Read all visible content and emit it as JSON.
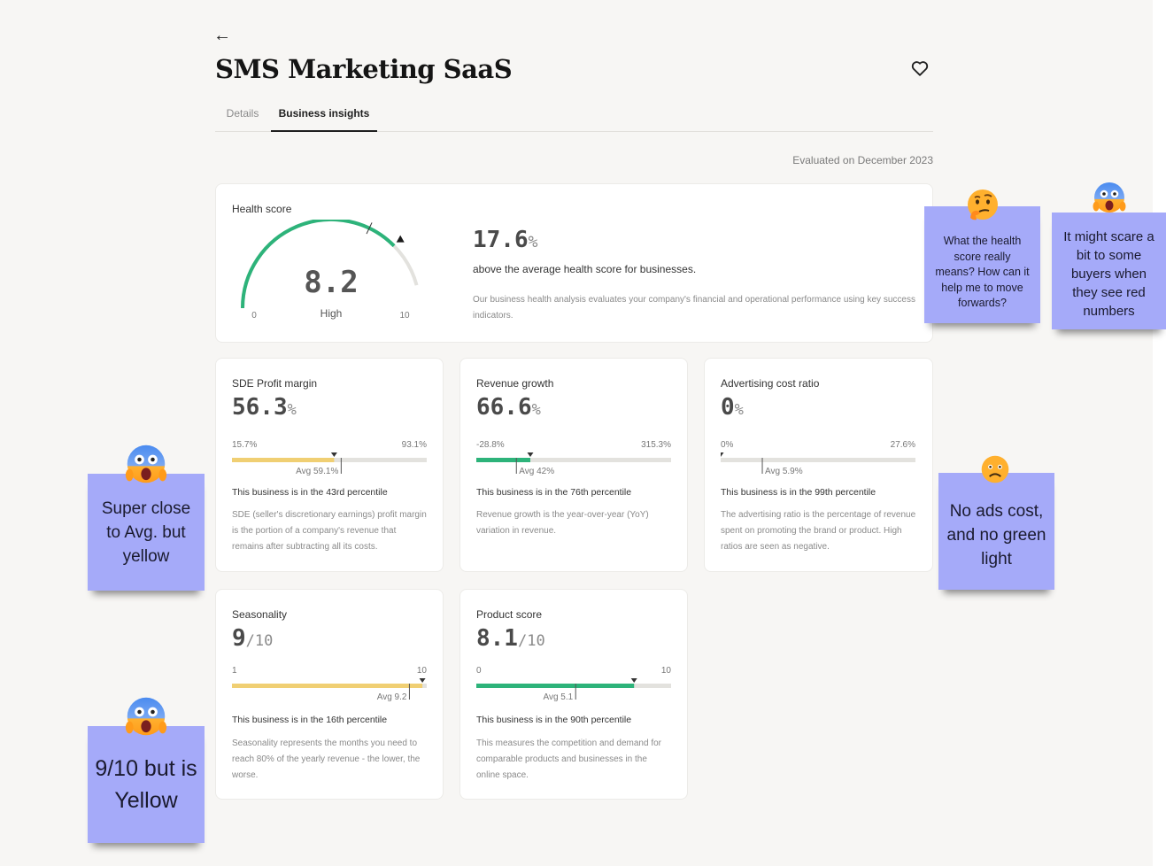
{
  "page": {
    "back_arrow": "←",
    "title": "SMS Marketing SaaS",
    "favorite_icon": "heart-outline-icon",
    "tabs": [
      {
        "label": "Details",
        "active": false
      },
      {
        "label": "Business insights",
        "active": true
      }
    ],
    "evaluated": "Evaluated on December 2023"
  },
  "health": {
    "label": "Health score",
    "score": "8.2",
    "score_value": 8.2,
    "level": "High",
    "min": "0",
    "max": "10",
    "avg_marker": 7.0,
    "above_value": "17.6",
    "above_unit": "%",
    "above_text": "above the average health score for businesses.",
    "description": "Our business health analysis evaluates your company's financial and operational performance using key success indicators."
  },
  "metrics": [
    {
      "label": "SDE Profit margin",
      "value": "56.3",
      "unit": "%",
      "min_label": "15.7%",
      "max_label": "93.1%",
      "min": 15.7,
      "max": 93.1,
      "current": 56.3,
      "avg": 59.1,
      "avg_label": "Avg 59.1%",
      "fill_color": "#f0cf73",
      "percentile": "This business is in the 43rd percentile",
      "description": "SDE (seller's discretionary earnings) profit margin is the portion of a company's revenue that remains after subtracting all its costs."
    },
    {
      "label": "Revenue growth",
      "value": "66.6",
      "unit": "%",
      "min_label": "-28.8%",
      "max_label": "315.3%",
      "min": -28.8,
      "max": 315.3,
      "current": 66.6,
      "avg": 42,
      "avg_label": "Avg 42%",
      "fill_color": "#2db37a",
      "percentile": "This business is in the 76th percentile",
      "description": "Revenue growth is the year-over-year (YoY) variation in revenue."
    },
    {
      "label": "Advertising cost ratio",
      "value": "0",
      "unit": "%",
      "min_label": "0%",
      "max_label": "27.6%",
      "min": 0,
      "max": 27.6,
      "current": 0,
      "avg": 5.9,
      "avg_label": "Avg 5.9%",
      "fill_color": "#2db37a",
      "percentile": "This business is in the 99th percentile",
      "description": "The advertising ratio is the percentage of revenue spent on promoting the brand or product. High ratios are seen as negative."
    },
    {
      "label": "Seasonality",
      "value": "9",
      "unit": "/10",
      "min_label": "1",
      "max_label": "10",
      "min": 1,
      "max": 10,
      "current": 9.8,
      "avg": 9.2,
      "avg_label": "Avg 9.2",
      "fill_color": "#f0cf73",
      "percentile": "This business is in the 16th percentile",
      "description": "Seasonality represents the months you need to reach 80% of the yearly revenue - the lower, the worse."
    },
    {
      "label": "Product score",
      "value": "8.1",
      "unit": "/10",
      "min_label": "0",
      "max_label": "10",
      "min": 0,
      "max": 10,
      "current": 8.1,
      "avg": 5.1,
      "avg_label": "Avg 5.1",
      "fill_color": "#2db37a",
      "percentile": "This business is in the 90th percentile",
      "description": "This measures the competition and demand for comparable products and businesses in the online space."
    }
  ],
  "notes": [
    {
      "text": "What the health score really means? How can it help me to move forwards?",
      "emoji": "thinking-face-emoji"
    },
    {
      "text": "It might scare a bit to some buyers when they see red numbers",
      "emoji": "screaming-face-emoji"
    },
    {
      "text": "Super close to Avg. but yellow",
      "emoji": "screaming-face-emoji"
    },
    {
      "text": "No ads cost, and no green light",
      "emoji": "frowning-face-emoji"
    },
    {
      "text": "9/10 but is Yellow",
      "emoji": "screaming-face-emoji"
    }
  ],
  "colors": {
    "green": "#2db37a",
    "yellow": "#f0cf73",
    "track": "#e3e2de",
    "note": "#a5aaf9"
  }
}
